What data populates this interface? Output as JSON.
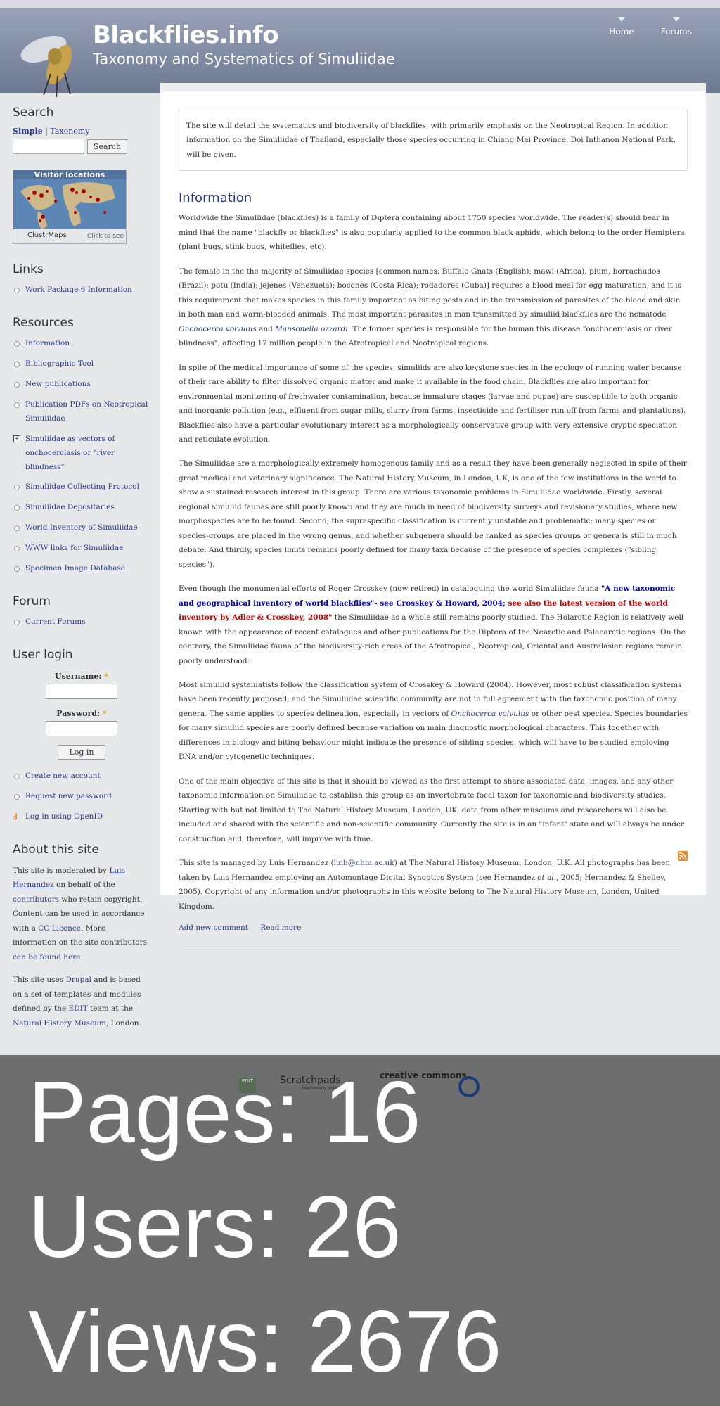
{
  "header": {
    "site_name": "Blackflies.info",
    "slogan": "Taxonomy and Systematics of Simuliidae",
    "nav": [
      "Home",
      "Forums"
    ]
  },
  "sidebar": {
    "search": {
      "title": "Search",
      "tab_simple": "Simple",
      "tab_separator": "|",
      "tab_taxonomy": "Taxonomy",
      "button": "Search",
      "widget_title": "Visitor locations",
      "widget_brand": "ClustrMaps",
      "widget_cta": "Click to see"
    },
    "links": {
      "title": "Links",
      "items": [
        "Work Package 6 Information"
      ]
    },
    "resources": {
      "title": "Resources",
      "items": [
        "Information",
        "Bibliographic Tool",
        "New publications",
        "Publication PDFs on Neotropical Simuliidae",
        "Simuliidae as vectors of onchocerciasis or \"river blindness\"",
        "Simuliidae Collecting Protocol",
        "Simuliidae Depositaries",
        "World Inventory of Simuliidae",
        "WWW links for Simuliidae",
        "Specimen Image Database"
      ]
    },
    "forum": {
      "title": "Forum",
      "items": [
        "Current Forums"
      ]
    },
    "login": {
      "title": "User login",
      "username_label": "Username:",
      "password_label": "Password:",
      "required_mark": "*",
      "button": "Log in",
      "links": [
        "Create new account",
        "Request new password",
        "Log in using OpenID"
      ]
    },
    "about": {
      "title": "About this site",
      "p1_a": "This site is moderated by ",
      "p1_link1": "Luis Hernandez",
      "p1_b": " on behalf of the ",
      "p1_link2": "contributors",
      "p1_c": " who retain copyright. Content can be used in accordance with a ",
      "p1_link3": "CC Licence",
      "p1_d": ". More information on the site contributors ",
      "p1_link4": "can be found here",
      "p1_e": ".",
      "p2_a": "This site uses ",
      "p2_link1": "Drupal",
      "p2_b": " and is based on a set of templates and modules defined by the ",
      "p2_link2": "EDIT",
      "p2_c": " team at the ",
      "p2_link3": "Natural History Museum",
      "p2_d": ", London."
    }
  },
  "content": {
    "intro": "The site will detail the systematics and biodiversity of blackflies, with primarily emphasis on the Neotropical Region. In addition, information on the Simuliidae of Thailand, especially those species occurring in Chiang Mai Province, Doi Inthanon National Park, will be given.",
    "title": "Information",
    "p1": "Worldwide the Simuliidae (blackflies) is a family of Diptera containing about 1750 species worldwide. The reader(s) should bear in mind that the name \"blackfly or blackflies\" is also popularly applied to the common black aphids, which belong to the order Hemiptera (plant bugs, stink bugs, whiteflies, etc).",
    "p2_a": "The female in the the majority of Simuliidae species [common names: Buffalo Gnats (English); mawi (Africa); pium, borrachudos (Brazil); potu (India); jejenes (Venezuela); bocones (Costa Rica); rodadores (Cuba)] requires a blood meal for egg maturation, and it is this requirement that makes species in this family important as biting pests and in the transmission of parasites of the blood and skin in both man and warm-blooded animals. The most important parasites in man transmitted by simuliid blackflies are the nematode ",
    "p2_link1": "Onchocerca volvulus",
    "p2_b": " and ",
    "p2_link2": "Mansonella ozzardi",
    "p2_c": ". The former species is responsible for the human this disease \"onchocerciasis or river blindness\", affecting 17 million people in the Afrotropical and Neotropical regions.",
    "p3": "In spite of the medical importance of some of the species, simuliids are also keystone species in the ecology of running water because of their rare ability to filter dissolved organic matter and make it available in the food chain. Blackflies are also important for environmental monitoring of freshwater contamination, because immature stages (larvae and pupae) are susceptible to both organic and inorganic pollution (e.g., effluent from sugar mills, slurry from farms, insecticide and fertiliser run off from farms and plantations). Blackflies also have a particular evolutionary interest as a morphologically conservative group with very extensive cryptic speciation and reticulate evolution.",
    "p4": "The Simuliidae are a morphologically extremely homogenous family and as a result they have been generally neglected in spite of their great medical and veterinary significance. The Natural History Museum, in London, UK, is one of the few institutions in the world to show a sustained research interest in this group. There are various taxonomic problems in Simuliidae worldwide. Firstly, several regional simuliid faunas are still poorly known and they are much in need of biodiversity surveys and revisionary studies, where new morphospecies are to be found. Second, the supraspecific classification is currently unstable and problematic; many species or species-groups are placed in the wrong genus, and whether subgenera should be ranked as species groups or genera is still in much debate. And thirdly, species limits remains poorly defined for many taxa because of the presence of species complexes (\"sibling species\").",
    "p5_a": "Even though the monumental efforts of Roger Crosskey (now retired) in cataloguing the world Simuliidae fauna ",
    "p5_blue": "\"A new taxonomic and geographical inventory of world blackflies\"- see Crosskey & Howard, 2004;",
    "p5_red": " see also the latest version of the world inventory by Adler & Crosskey, 2008\"",
    "p5_b": " the Simuliidae as a whole still remains poorly studied. The Holarctic Region is relatively well known with the appearance of recent catalogues and other publications for the Diptera of the Nearctic and Palaearctic regions. On the contrary, the Simuliidae fauna of the biodiversity-rich areas of the Afrotropical, Neotropical, Oriental and Australasian regions remain poorly understood.",
    "p6_a": "Most simuliid systematists follow the classification system of Crosskey & Howard (2004). However, most robust classification systems have been recently proposed, and the Simuliidae scientific community are not in full agreement with the taxonomic position of many genera. The same applies to species delineation, especially in vectors of ",
    "p6_link": "Onchocerca volvulus",
    "p6_b": " or other pest species. Species boundaries for many simuliid species are poorly defined because variation on main diagnostic morphological characters. This together with differences in biology and biting behaviour might indicate the presence of sibling species, which will have to be studied employing DNA and/or cytogenetic techniques.",
    "p7": "One of the main objective of this site is that it should be viewed as the first attempt to share associated data, images, and any other taxonomic information on Simuliidae to establish this group as an invertebrate focal taxon for taxonomic and biodiversity studies. Starting with but not limited to The Natural History Museum, London, UK, data from other museums and researchers will also be included and shared with the scientific and non-scientific community. Currently the site is in an \"infant\" state and will always be under construction and, therefore, will improve with time.",
    "p8_a": "This site is managed by Luis Hernandez (",
    "p8_link": "luih@nhm.ac.uk",
    "p8_b": ") at The Natural History Museum, London, U.K. All photographs has been taken by Luis Hernandez employing an Automontage Digital Synoptics System (see Hernandez ",
    "p8_etal": "et al.",
    "p8_c": ", 2005; Hernandez & Shelley, 2005). Copyright of any information and/or photographs in this website belong to The Natural History Museum, London, United Kingdom.",
    "links": [
      "Add new comment",
      "Read more"
    ]
  },
  "footer": {
    "badge_edit": "EDIT",
    "badge_scratchpads": "Scratchpads",
    "badge_scratchpads_sub": "biodiversity online",
    "badge_cc": "creative commons",
    "stats": [
      "Pages: 16",
      "Users: 26",
      "Views: 2676"
    ]
  },
  "colors": {
    "link": "#2a3a8a",
    "highlight_blue": "#0000cc",
    "highlight_red": "#d00000",
    "header": "#6d7892",
    "overlay": "#6e6e6e"
  }
}
